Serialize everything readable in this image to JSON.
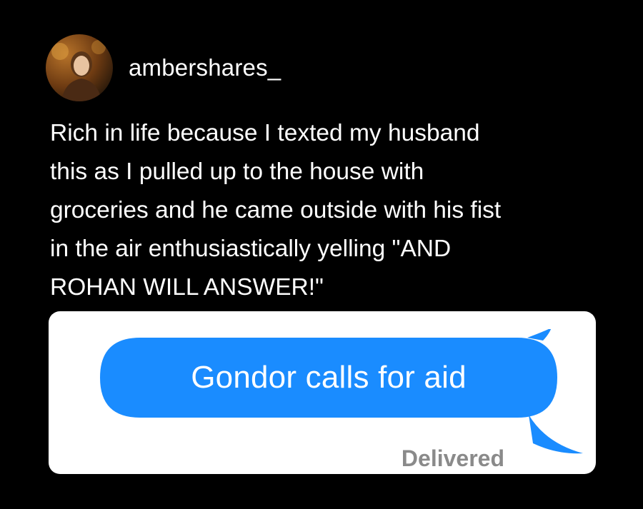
{
  "post": {
    "username": "ambershares_",
    "caption": "Rich in life because I texted my husband\nthis as I pulled up to the house with\ngroceries and he came outside with his fist\nin the air enthusiastically yelling \"AND\nROHAN WILL ANSWER!\""
  },
  "message": {
    "text": "Gondor calls for aid",
    "status": "Delivered",
    "bubble_color": "#1a8cff"
  },
  "icons": {
    "avatar": "profile-photo"
  }
}
